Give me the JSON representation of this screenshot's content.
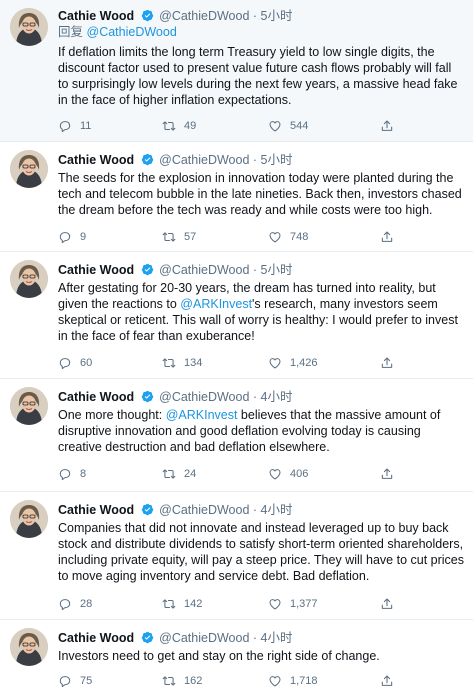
{
  "tweets": [
    {
      "name": "Cathie Wood",
      "handle": "@CathieDWood",
      "dot": "·",
      "time": "5小时",
      "replying_prefix": "回复",
      "replying_to": "@CathieDWood",
      "text": "If deflation limits the long term Treasury yield to low single digits, the discount factor used to present value future cash flows probably will fall to surprisingly low levels during the next few years, a massive head fake in the face of higher inflation expectations.",
      "replies": "11",
      "retweets": "49",
      "likes": "544"
    },
    {
      "name": "Cathie Wood",
      "handle": "@CathieDWood",
      "dot": "·",
      "time": "5小时",
      "text": "The seeds for the explosion in innovation today were planted during the tech and telecom bubble in the late nineties. Back then, investors chased the dream before the tech was ready and while costs were too high.",
      "replies": "9",
      "retweets": "57",
      "likes": "748"
    },
    {
      "name": "Cathie Wood",
      "handle": "@CathieDWood",
      "dot": "·",
      "time": "5小时",
      "text_before": "After gestating for 20-30 years, the dream has turned into reality, but given the reactions to ",
      "mention": "@ARKInvest",
      "text_after": "'s research, many investors seem skeptical or reticent. This wall of worry is healthy: I would prefer to invest in the face of fear than exuberance!",
      "replies": "60",
      "retweets": "134",
      "likes": "1,426"
    },
    {
      "name": "Cathie Wood",
      "handle": "@CathieDWood",
      "dot": "·",
      "time": "4小时",
      "text_before": "One more thought: ",
      "mention": "@ARKInvest",
      "text_after": " believes that the massive amount of disruptive innovation and good deflation evolving today is causing creative destruction and bad deflation elsewhere.",
      "replies": "8",
      "retweets": "24",
      "likes": "406"
    },
    {
      "name": "Cathie Wood",
      "handle": "@CathieDWood",
      "dot": "·",
      "time": "4小时",
      "text": "Companies that did not innovate and instead leveraged up to buy back stock and distribute dividends to satisfy short-term oriented shareholders, including private equity, will pay a steep price. They will have to cut prices to move aging inventory and service debt. Bad deflation.",
      "replies": "28",
      "retweets": "142",
      "likes": "1,377"
    },
    {
      "name": "Cathie Wood",
      "handle": "@CathieDWood",
      "dot": "·",
      "time": "4小时",
      "text": "Investors need to get and stay on the right side of change.",
      "replies": "75",
      "retweets": "162",
      "likes": "1,718"
    }
  ],
  "colors": {
    "link": "#1b95e0",
    "muted": "#5b7083",
    "divider": "#e6ecf0",
    "highlight_bg": "#f5f8fa"
  },
  "icons": {
    "reply": "reply-icon",
    "retweet": "retweet-icon",
    "like": "heart-icon",
    "share": "share-icon",
    "verified": "verified-badge-icon"
  }
}
